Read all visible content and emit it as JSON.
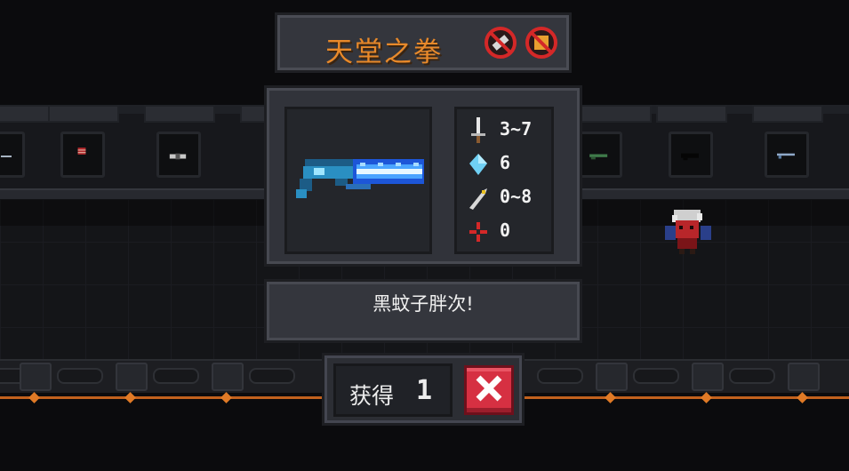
{
  "item": {
    "name": "天堂之拳",
    "description": "黑蚊子胖次!",
    "badges": [
      "no-melee-icon",
      "no-ammo-icon"
    ]
  },
  "stats": {
    "damage": "3~7",
    "energy": "6",
    "crit": "0~8",
    "spread": "0"
  },
  "obtain": {
    "label": "获得",
    "count": "1",
    "close_icon": "close-x-icon"
  },
  "colors": {
    "title": "#e8892a",
    "close_button": "#d63042",
    "accent_line": "#c2611d"
  }
}
